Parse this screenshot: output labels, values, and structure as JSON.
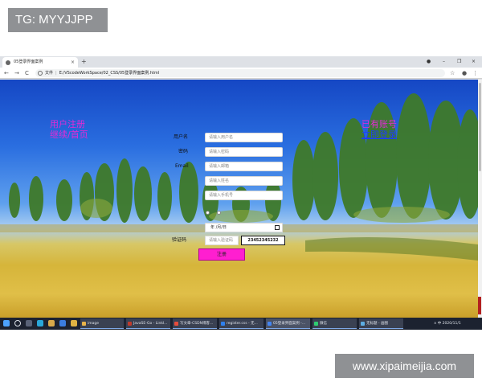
{
  "watermarks": {
    "top_tag": "TG: MYYJJPP",
    "bottom_site": "www.xipaimeijia.com"
  },
  "browser": {
    "tab_title": "05登录界面案例",
    "tab_close": "×",
    "new_tab": "+",
    "window_controls": [
      "–",
      "❐",
      "×"
    ],
    "nav": [
      "←",
      "→",
      "C"
    ],
    "address": {
      "scheme_label": "文件",
      "path": "E:/VScodeWorkSpace/02_CSS/05登录界面案例.html"
    },
    "toolbar_right": [
      "☆",
      "●",
      "⋮"
    ]
  },
  "page": {
    "left_link": [
      "用户注册",
      "继续/首页"
    ],
    "right_link": [
      "已有账号",
      "立即登录"
    ],
    "fields": [
      {
        "label": "用户名",
        "placeholder": "请输入用户名"
      },
      {
        "label": "密码",
        "placeholder": "请输入密码"
      },
      {
        "label": "Email",
        "placeholder": "请输入邮箱"
      },
      {
        "label": "",
        "placeholder": "请输入姓名"
      },
      {
        "label": "",
        "placeholder": "请输入手机号"
      }
    ],
    "date_value": "年 /月/日",
    "captcha": {
      "label": "验证码",
      "placeholder": "请输入验证码",
      "code": "23452345232"
    },
    "submit_label": "注册"
  },
  "taskbar": {
    "items": [
      {
        "label": "image",
        "color": "#e8b34a"
      },
      {
        "label": "JavaSE-Go - Linkl...",
        "color": "#c0392b"
      },
      {
        "label": "写文章-CSDN博客...",
        "color": "#e74c3c"
      },
      {
        "label": "register.css - 无...",
        "color": "#2f80ed"
      },
      {
        "label": "05登录界面案例 -...",
        "color": "#4285f4"
      },
      {
        "label": "微信",
        "color": "#2ecc71"
      },
      {
        "label": "无标题 - 画图",
        "color": "#5dade2"
      }
    ],
    "tray_text": "∧ 中 2020/11/1",
    "colors": {
      "bar": "#1c2230",
      "accent": "#ff1fd0",
      "link": "#e52ad6"
    }
  }
}
